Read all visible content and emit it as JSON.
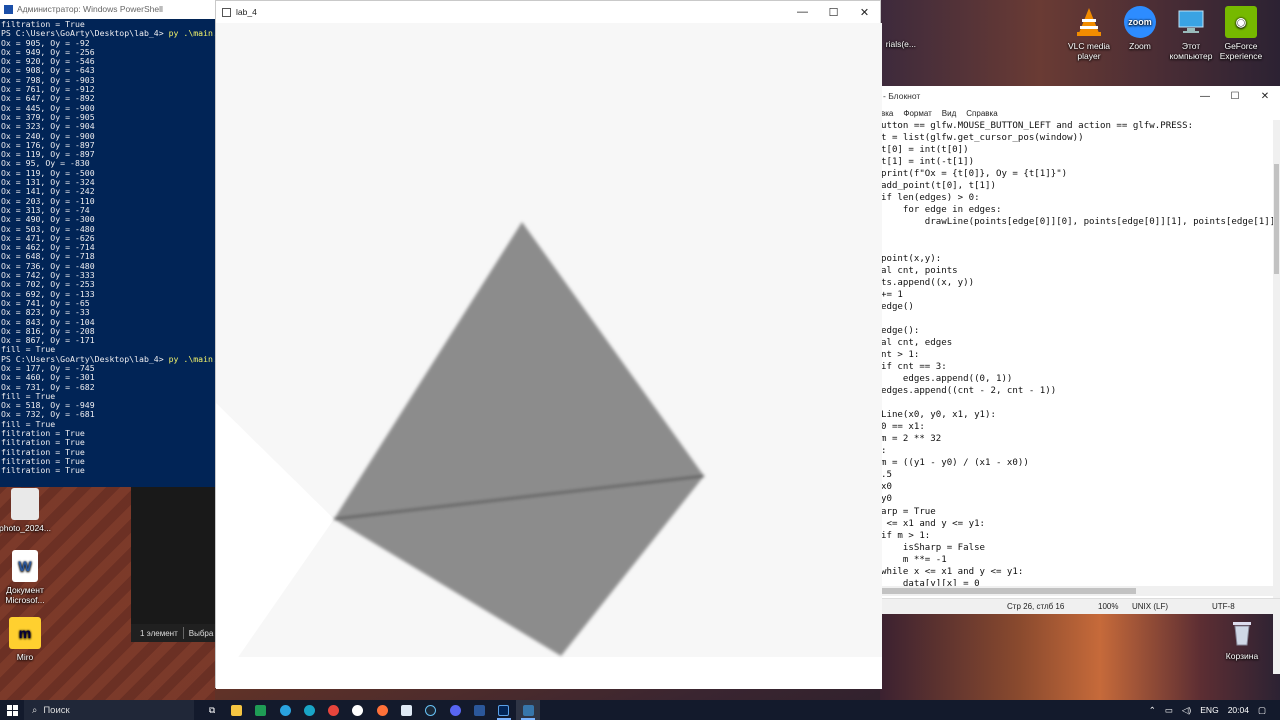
{
  "powershell": {
    "title": "Администратор: Windows PowerShell",
    "lines": [
      {
        "text": "filtration = True"
      },
      {
        "prompt": "PS C:\\Users\\GoArty\\Desktop\\lab_4> ",
        "cmd": "py .\\main.py"
      },
      {
        "text": "Ox = 905, Oy = -92"
      },
      {
        "text": "Ox = 949, Oy = -256"
      },
      {
        "text": "Ox = 920, Oy = -546"
      },
      {
        "text": "Ox = 908, Oy = -643"
      },
      {
        "text": "Ox = 798, Oy = -903"
      },
      {
        "text": "Ox = 761, Oy = -912"
      },
      {
        "text": "Ox = 647, Oy = -892"
      },
      {
        "text": "Ox = 445, Oy = -900"
      },
      {
        "text": "Ox = 379, Oy = -905"
      },
      {
        "text": "Ox = 323, Oy = -904"
      },
      {
        "text": "Ox = 240, Oy = -900"
      },
      {
        "text": "Ox = 176, Oy = -897"
      },
      {
        "text": "Ox = 119, Oy = -897"
      },
      {
        "text": "Ox = 95, Oy = -830"
      },
      {
        "text": "Ox = 119, Oy = -500"
      },
      {
        "text": "Ox = 131, Oy = -324"
      },
      {
        "text": "Ox = 141, Oy = -242"
      },
      {
        "text": "Ox = 203, Oy = -110"
      },
      {
        "text": "Ox = 313, Oy = -74"
      },
      {
        "text": "Ox = 490, Oy = -300"
      },
      {
        "text": "Ox = 503, Oy = -480"
      },
      {
        "text": "Ox = 471, Oy = -626"
      },
      {
        "text": "Ox = 462, Oy = -714"
      },
      {
        "text": "Ox = 648, Oy = -718"
      },
      {
        "text": "Ox = 736, Oy = -480"
      },
      {
        "text": "Ox = 742, Oy = -333"
      },
      {
        "text": "Ox = 702, Oy = -253"
      },
      {
        "text": "Ox = 692, Oy = -133"
      },
      {
        "text": "Ox = 741, Oy = -65"
      },
      {
        "text": "Ox = 823, Oy = -33"
      },
      {
        "text": "Ox = 843, Oy = -104"
      },
      {
        "text": "Ox = 816, Oy = -208"
      },
      {
        "text": "Ox = 867, Oy = -171"
      },
      {
        "text": "fill = True"
      },
      {
        "prompt": "PS C:\\Users\\GoArty\\Desktop\\lab_4> ",
        "cmd": "py .\\main.py"
      },
      {
        "text": "Ox = 177, Oy = -745"
      },
      {
        "text": "Ox = 460, Oy = -301"
      },
      {
        "text": "Ox = 731, Oy = -682"
      },
      {
        "text": "fill = True"
      },
      {
        "text": "Ox = 518, Oy = -949"
      },
      {
        "text": "Ox = 732, Oy = -681"
      },
      {
        "text": "fill = True"
      },
      {
        "text": "filtration = True"
      },
      {
        "text": "filtration = True"
      },
      {
        "text": "filtration = True"
      },
      {
        "text": "filtration = True"
      },
      {
        "text": "filtration = True"
      }
    ]
  },
  "explorer": {
    "status_count": "1 элемент",
    "status_selected": "Выбра"
  },
  "lab_window": {
    "title": "lab_4",
    "fill_color": "#8c8c8c",
    "edge_color": "#555555",
    "background": "#f7f7f7"
  },
  "notepad": {
    "title": "- Блокнот",
    "menu": [
      "вка",
      "Формат",
      "Вид",
      "Справка"
    ],
    "lines": [
      "utton == glfw.MOUSE_BUTTON_LEFT and action == glfw.PRESS:",
      "t = list(glfw.get_cursor_pos(window))",
      "t[0] = int(t[0])",
      "t[1] = int(-t[1])",
      "print(f\"Ox = {t[0]}, Oy = {t[1]}\")",
      "add_point(t[0], t[1])",
      "if len(edges) > 0:",
      "    for edge in edges:",
      "        drawLine(points[edge[0]][0], points[edge[0]][1], points[edge[1]][0",
      "",
      "",
      "point(x,y):",
      "al cnt, points",
      "ts.append((x, y))",
      "+= 1",
      "edge()",
      "",
      "edge():",
      "al cnt, edges",
      "nt > 1:",
      "if cnt == 3:",
      "    edges.append((0, 1))",
      "edges.append((cnt - 2, cnt - 1))",
      "",
      "Line(x0, y0, x1, y1):",
      "0 == x1:",
      "m = 2 ** 32",
      ":",
      "m = ((y1 - y0) / (x1 - x0))",
      ".5",
      "x0",
      "y0",
      "arp = True",
      " <= x1 and y <= y1:",
      "if m > 1:",
      "    isSharp = False",
      "    m **= -1",
      "while x <= x1 and y <= y1:",
      "    data[y][x] = 0"
    ],
    "status": {
      "position": "Стр 26, стлб 16",
      "zoom": "100%",
      "eol": "UNIX (LF)",
      "encoding": "UTF-8"
    }
  },
  "desktop_icons": {
    "vlc": "VLC media player",
    "zoom": "Zoom",
    "this_pc": "Этот компьютер",
    "geforce": "GeForce Experience",
    "partial_left": "rials(e...",
    "photo": "photo_2024...",
    "word": "Документ Microsof...",
    "miro": "Miro",
    "recycle": "Корзина"
  },
  "taskbar": {
    "search_label": "Поиск",
    "language": "ENG",
    "time": "20:04"
  }
}
